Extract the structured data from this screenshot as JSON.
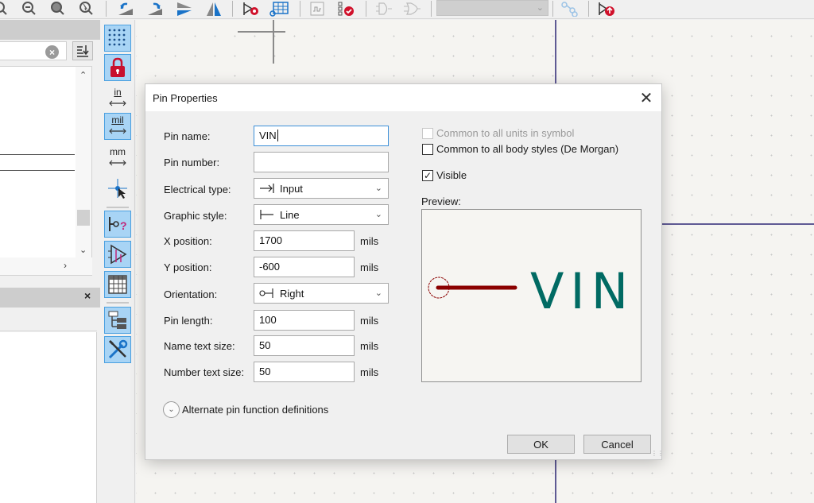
{
  "toolbar": {
    "icons": [
      "zoom-out-partial-icon",
      "zoom-out-icon",
      "zoom-fit-icon",
      "zoom-selection-icon",
      "rotate-ccw-icon",
      "rotate-cw-icon",
      "mirror-vertical-icon",
      "mirror-horizontal-icon",
      "symbol-properties-icon",
      "pin-table-icon",
      "simulation-model-icon",
      "check-symbol-icon",
      "deMorgan-standard-icon",
      "deMorgan-alternate-icon",
      "unit-selector",
      "show-associated-footprint-icon",
      "update-symbol-icon"
    ],
    "unit_selector_value": ""
  },
  "left_panel": {
    "search": {
      "value": "",
      "placeholder": ""
    },
    "properties_panel_close": "×"
  },
  "vtoolbar": {
    "units": {
      "in": "in",
      "mil": "mil",
      "mm": "mm"
    },
    "active": [
      "grid",
      "lock",
      "mil",
      "pin-type",
      "electrical-type",
      "pin-table",
      "hierarchy",
      "tools"
    ]
  },
  "dialog": {
    "title": "Pin Properties",
    "close": "✕",
    "fields": {
      "pin_name": {
        "label": "Pin name:",
        "value": "VIN"
      },
      "pin_number": {
        "label": "Pin number:",
        "value": ""
      },
      "electrical_type": {
        "label": "Electrical type:",
        "value": "Input"
      },
      "graphic_style": {
        "label": "Graphic style:",
        "value": "Line"
      },
      "x_position": {
        "label": "X position:",
        "value": "1700",
        "unit": "mils"
      },
      "y_position": {
        "label": "Y position:",
        "value": "-600",
        "unit": "mils"
      },
      "orientation": {
        "label": "Orientation:",
        "value": "Right"
      },
      "pin_length": {
        "label": "Pin length:",
        "value": "100",
        "unit": "mils"
      },
      "name_text_size": {
        "label": "Name text size:",
        "value": "50",
        "unit": "mils"
      },
      "number_text_size": {
        "label": "Number text size:",
        "value": "50",
        "unit": "mils"
      }
    },
    "checkboxes": {
      "common_units": {
        "label": "Common to all units in symbol",
        "checked": false,
        "disabled": true
      },
      "common_body_styles": {
        "label": "Common to all body styles (De Morgan)",
        "checked": false,
        "disabled": false
      },
      "visible": {
        "label": "Visible",
        "checked": true,
        "disabled": false
      }
    },
    "preview": {
      "label": "Preview:",
      "pin_name_text": "VIN",
      "pin_color": "#8b0000",
      "name_color": "#006a63"
    },
    "alternate_toggle": "Alternate pin function definitions",
    "ok": "OK",
    "cancel": "Cancel"
  }
}
